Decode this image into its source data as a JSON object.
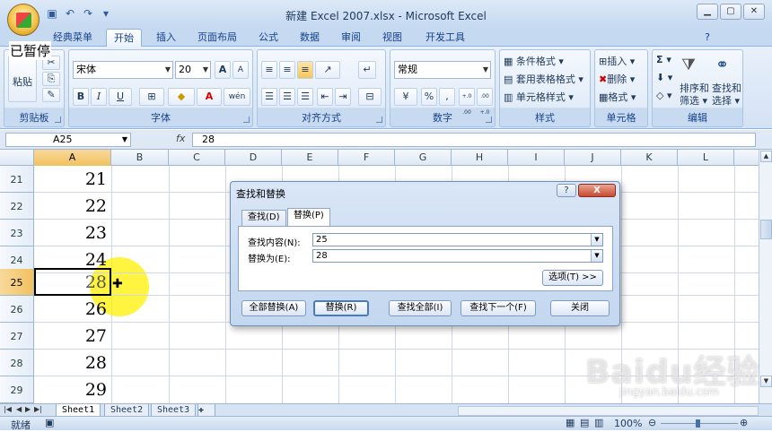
{
  "window": {
    "title": "新建 Excel 2007.xlsx - Microsoft Excel",
    "overlay_text": "已暂停"
  },
  "tabs": [
    "经典菜单",
    "开始",
    "插入",
    "页面布局",
    "公式",
    "数据",
    "审阅",
    "视图",
    "开发工具"
  ],
  "active_tab": "开始",
  "ribbon": {
    "clipboard": {
      "paste": "粘贴",
      "label": "剪贴板"
    },
    "font": {
      "name": "宋体",
      "size": "20",
      "label": "字体",
      "bold": "B",
      "italic": "I",
      "underline": "U",
      "grow": "A",
      "shrink": "A",
      "wen": "wén",
      "font_color_glyph": "A"
    },
    "alignment": {
      "label": "对齐方式"
    },
    "number": {
      "format": "常规",
      "percent": "%",
      "comma": ",",
      "inc": "+.0 .00",
      "dec": ".00 +.0",
      "label": "数字"
    },
    "styles": {
      "conditional": "条件格式",
      "table": "套用表格格式",
      "cell": "单元格样式",
      "label": "样式"
    },
    "cells": {
      "insert": "插入",
      "delete": "删除",
      "format": "格式",
      "label": "单元格"
    },
    "editing": {
      "sort": "排序和",
      "sort2": "筛选",
      "find": "查找和",
      "find2": "选择",
      "sigma": "Σ",
      "label": "编辑"
    }
  },
  "formula_bar": {
    "name_box": "A25",
    "fx": "fx",
    "value": "28"
  },
  "columns": [
    "A",
    "B",
    "C",
    "D",
    "E",
    "F",
    "G",
    "H",
    "I",
    "J",
    "K",
    "L"
  ],
  "rows": [
    {
      "num": "21",
      "a": "21"
    },
    {
      "num": "22",
      "a": "22"
    },
    {
      "num": "23",
      "a": "23"
    },
    {
      "num": "24",
      "a": "24"
    },
    {
      "num": "25",
      "a": "28"
    },
    {
      "num": "26",
      "a": "26"
    },
    {
      "num": "27",
      "a": "27"
    },
    {
      "num": "28",
      "a": "28"
    },
    {
      "num": "29",
      "a": "29"
    }
  ],
  "dialog": {
    "title": "查找和替换",
    "help": "?",
    "close": "X",
    "tab_find": "查找(D)",
    "tab_replace": "替换(P)",
    "find_label": "查找内容(N):",
    "find_value": "25",
    "replace_label": "替换为(E):",
    "replace_value": "28",
    "options_button": "选项(T) >>",
    "replace_all": "全部替换(A)",
    "replace": "替换(R)",
    "find_all": "查找全部(I)",
    "find_next": "查找下一个(F)",
    "close_button": "关闭"
  },
  "sheets": [
    "Sheet1",
    "Sheet2",
    "Sheet3"
  ],
  "status": {
    "ready": "就绪",
    "zoom": "100%"
  },
  "watermark": {
    "text": "Baidu经验",
    "sub": "jingyan.baidu.com"
  }
}
